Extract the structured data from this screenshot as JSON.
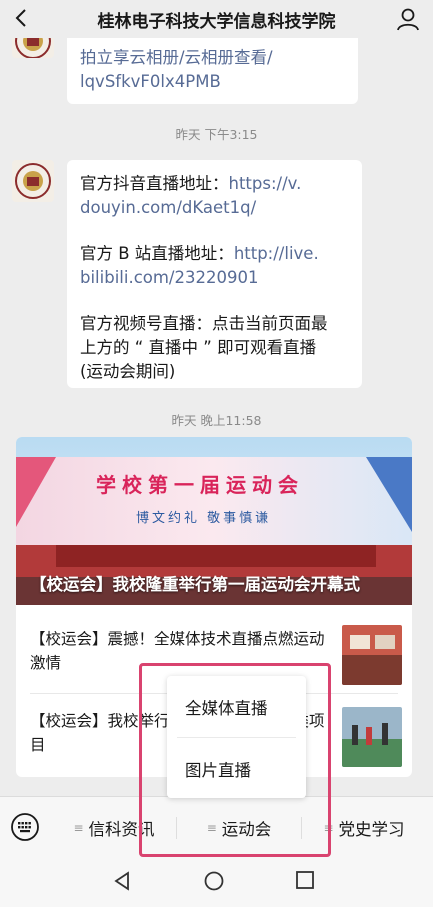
{
  "header": {
    "title": "桂林电子科技大学信息科技学院",
    "back_icon": "chevron-left-icon",
    "profile_icon": "person-icon"
  },
  "messages": [
    {
      "partial": true,
      "lines": [
        "拍立享云相册/云相册查看/",
        "lqvSfkvF0lx4PMB"
      ]
    },
    {
      "timestamp": "昨天 下午3:15",
      "douyin_label": "官方抖音直播地址：",
      "douyin_url_a": "https://v.",
      "douyin_url_b": "douyin.com/dKaet1q/",
      "bilibili_label": "官方 B 站直播地址：",
      "bilibili_url_a": "http://live.",
      "bilibili_url_b": "bilibili.com/23220901",
      "video_line1": "官方视频号直播：点击当前页面最",
      "video_line2": "上方的 “ 直播中 ” 即可观看直播",
      "video_line3": "(运动会期间)"
    }
  ],
  "article": {
    "timestamp": "昨天 晚上11:58",
    "cover_caption": "【校运会】我校隆重举行第一届运动会开幕式",
    "cover_banner_title": "学校第一届运动会",
    "cover_banner_subtitle": "博文约礼  敬事慎谦",
    "items": [
      {
        "title": "【校运会】震撼！全媒体技术直播点燃运动激情"
      },
      {
        "title": "【校运会】我校举行第一届运动会田径类项目"
      }
    ]
  },
  "menu": {
    "keyboard_icon": "keyboard-icon",
    "items": [
      {
        "label": "信科资讯"
      },
      {
        "label": "运动会"
      },
      {
        "label": "党史学习"
      }
    ]
  },
  "popup": {
    "items": [
      {
        "label": "全媒体直播"
      },
      {
        "label": "图片直播"
      }
    ]
  },
  "colors": {
    "link": "#576b95",
    "highlight": "#d9436f",
    "background": "#ededed"
  },
  "system_nav": {
    "back_icon": "triangle-back-icon",
    "home_icon": "circle-home-icon",
    "recents_icon": "square-recents-icon"
  }
}
